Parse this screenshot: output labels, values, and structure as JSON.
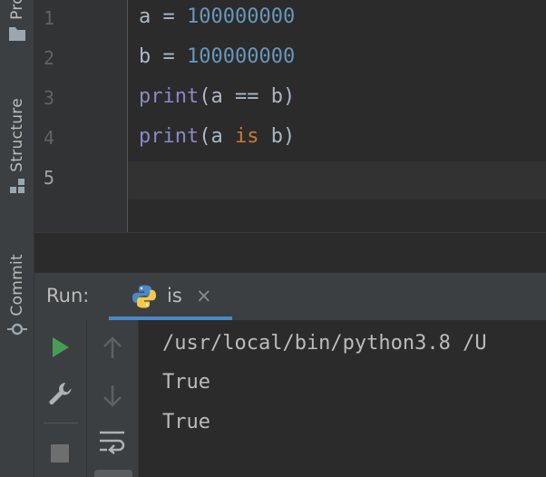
{
  "sidebar": {
    "project_label": "Pro",
    "structure_label": "Structure",
    "commit_label": "Commit"
  },
  "editor": {
    "lines": [
      {
        "number": "1",
        "tokens": [
          {
            "t": "a = ",
            "c": "plain"
          },
          {
            "t": "100000000",
            "c": "num"
          }
        ]
      },
      {
        "number": "2",
        "tokens": [
          {
            "t": "b = ",
            "c": "plain"
          },
          {
            "t": "100000000",
            "c": "num"
          }
        ]
      },
      {
        "number": "3",
        "tokens": [
          {
            "t": "print",
            "c": "builtin"
          },
          {
            "t": "(a == b)",
            "c": "plain"
          }
        ]
      },
      {
        "number": "4",
        "tokens": [
          {
            "t": "print",
            "c": "builtin"
          },
          {
            "t": "(a ",
            "c": "plain"
          },
          {
            "t": "is",
            "c": "kw"
          },
          {
            "t": " b)",
            "c": "plain"
          }
        ]
      },
      {
        "number": "5",
        "tokens": []
      }
    ],
    "active_line": "5"
  },
  "run": {
    "title": "Run:",
    "tab_label": "is",
    "tab_close": "×",
    "accent": "#4a88c7"
  },
  "toolbar": {
    "icons": [
      "run-icon",
      "wrench-icon",
      "stop-icon",
      "up-arrow-icon",
      "down-arrow-icon",
      "soft-wrap-icon"
    ]
  },
  "console": {
    "lines": [
      "/usr/local/bin/python3.8 /U",
      "True",
      "True"
    ]
  },
  "colors": {
    "number": "#6897bb",
    "builtin": "#8888c6",
    "keyword": "#cc7832",
    "run_green": "#499c54"
  }
}
